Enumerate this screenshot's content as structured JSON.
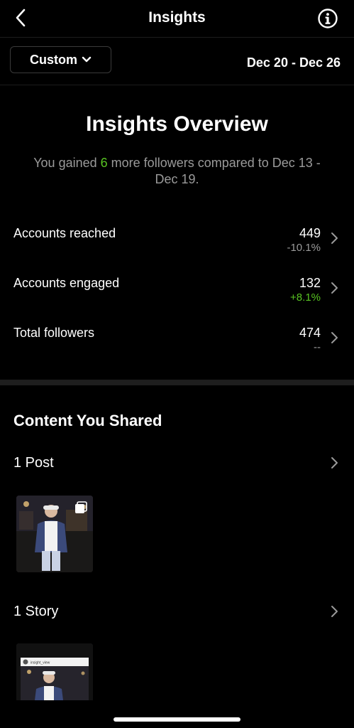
{
  "header": {
    "title": "Insights",
    "back_icon": "chevron-left-icon",
    "info_icon": "info-icon"
  },
  "filter": {
    "custom_label": "Custom",
    "date_range": "Dec 20 - Dec 26"
  },
  "overview": {
    "title": "Insights Overview",
    "subtitle_prefix": "You gained",
    "subtitle_count": "6",
    "subtitle_suffix": "more followers compared to Dec 13 - Dec 19."
  },
  "metrics": [
    {
      "label": "Accounts reached",
      "value": "449",
      "change": "-10.1%"
    },
    {
      "label": "Accounts engaged",
      "value": "132",
      "change": "+8.1%"
    },
    {
      "label": "Total followers",
      "value": "474",
      "change": "--"
    }
  ],
  "content": {
    "title": "Content You Shared",
    "posts_label": "1 Post",
    "stories_label": "1 Story",
    "story_header_text": "insight_view"
  },
  "colors": {
    "background": "#000000",
    "positive": "#58c322",
    "muted": "#9a9a9a"
  }
}
